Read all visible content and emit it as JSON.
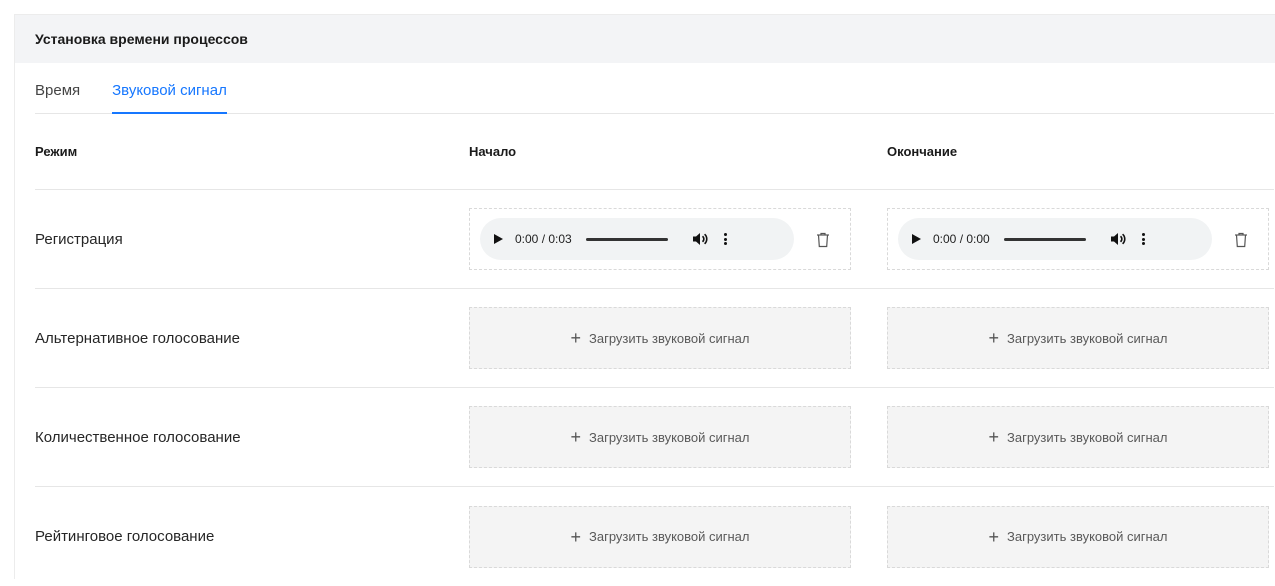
{
  "card": {
    "title": "Установка времени процессов"
  },
  "tabs": [
    {
      "label": "Время",
      "active": false
    },
    {
      "label": "Звуковой сигнал",
      "active": true
    }
  ],
  "table": {
    "headers": {
      "mode": "Режим",
      "start": "Начало",
      "end": "Окончание"
    },
    "rows": [
      {
        "mode": "Регистрация",
        "start": {
          "type": "audio",
          "time": "0:00 / 0:03"
        },
        "end": {
          "type": "audio",
          "time": "0:00 / 0:00"
        }
      },
      {
        "mode": "Альтернативное голосование",
        "start": {
          "type": "upload",
          "label": "Загрузить звуковой сигнал"
        },
        "end": {
          "type": "upload",
          "label": "Загрузить звуковой сигнал"
        }
      },
      {
        "mode": "Количественное голосование",
        "start": {
          "type": "upload",
          "label": "Загрузить звуковой сигнал"
        },
        "end": {
          "type": "upload",
          "label": "Загрузить звуковой сигнал"
        }
      },
      {
        "mode": "Рейтинговое голосование",
        "start": {
          "type": "upload",
          "label": "Загрузить звуковой сигнал"
        },
        "end": {
          "type": "upload",
          "label": "Загрузить звуковой сигнал"
        }
      }
    ]
  },
  "icons": {
    "play": "play-icon",
    "volume": "volume-icon",
    "more": "more-vertical-icon",
    "trash": "trash-icon",
    "plus": "plus-icon"
  },
  "colors": {
    "accent": "#1677ff",
    "header_bg": "#f3f4f6",
    "upload_bg": "#f4f4f4"
  }
}
